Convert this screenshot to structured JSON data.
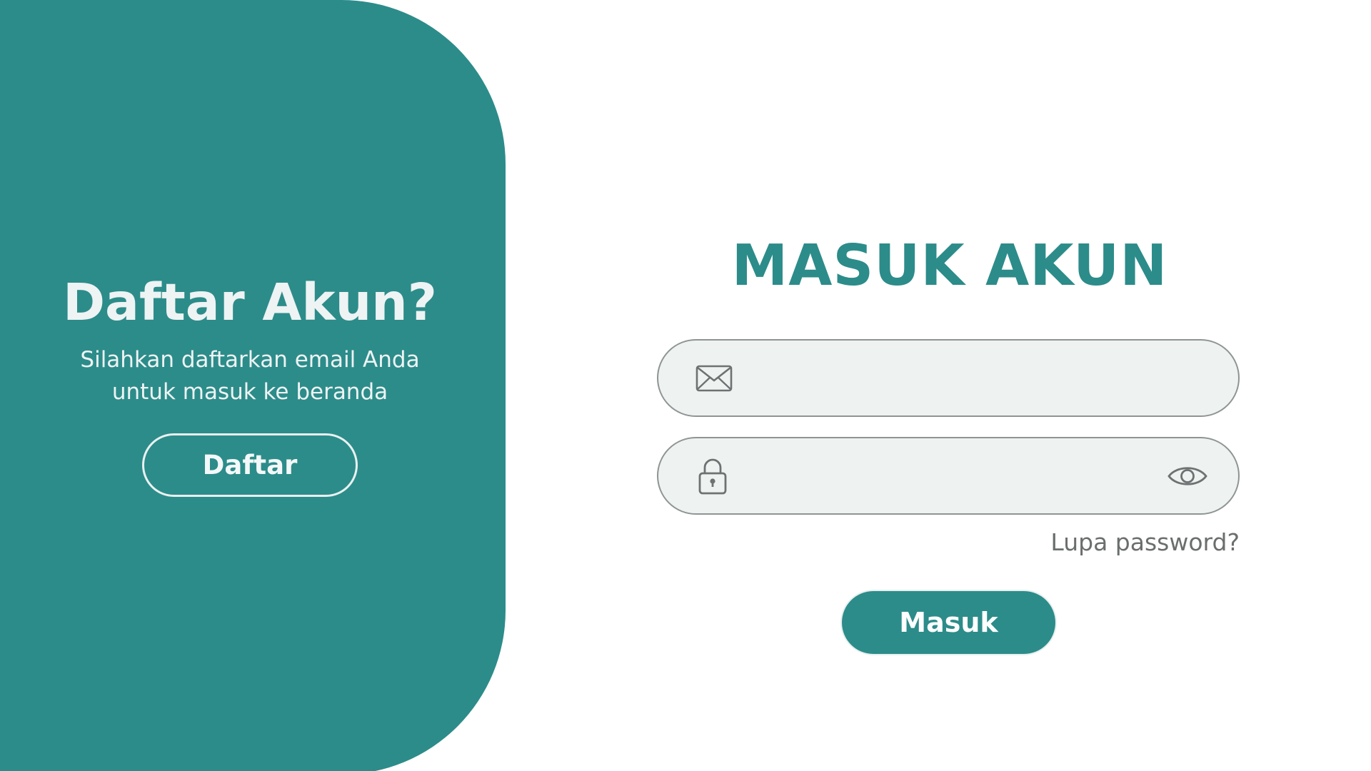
{
  "colors": {
    "accent": "#2c8c8a",
    "field_background": "#eef2f1",
    "field_border": "#8e9494",
    "muted_text": "#6b6e6e",
    "panel_text": "#eef3f3"
  },
  "register_panel": {
    "title": "Daftar Akun?",
    "subtitle_line1": "Silahkan daftarkan email Anda",
    "subtitle_line2": "untuk masuk ke beranda",
    "button_label": "Daftar"
  },
  "login_form": {
    "title": "MASUK AKUN",
    "email_field": {
      "icon": "mail-icon",
      "value": "",
      "placeholder": ""
    },
    "password_field": {
      "icon": "lock-icon",
      "toggle_icon": "eye-icon",
      "value": "",
      "placeholder": ""
    },
    "forgot_password_label": "Lupa password?",
    "submit_label": "Masuk"
  }
}
